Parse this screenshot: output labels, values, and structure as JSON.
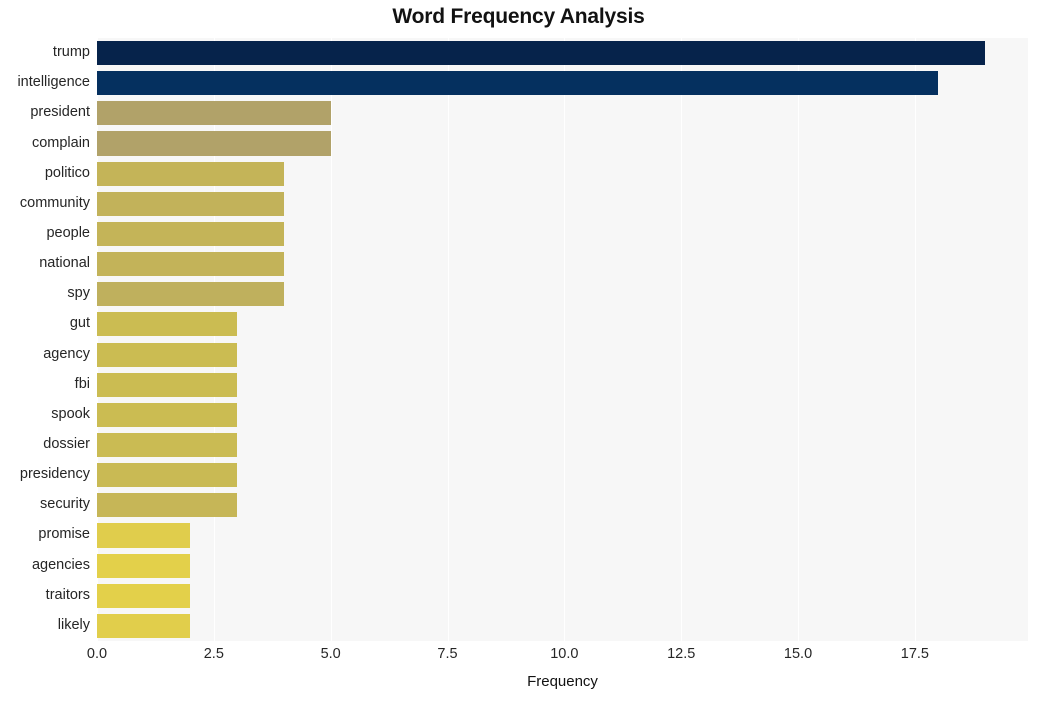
{
  "chart_data": {
    "type": "bar",
    "orientation": "horizontal",
    "title": "Word Frequency Analysis",
    "xlabel": "Frequency",
    "ylabel": "",
    "categories": [
      "trump",
      "intelligence",
      "president",
      "complain",
      "politico",
      "community",
      "people",
      "national",
      "spy",
      "gut",
      "agency",
      "fbi",
      "spook",
      "dossier",
      "presidency",
      "security",
      "promise",
      "agencies",
      "traitors",
      "likely"
    ],
    "values": [
      19,
      18,
      5,
      5,
      4,
      4,
      4,
      4,
      4,
      3,
      3,
      3,
      3,
      3,
      3,
      3,
      2,
      2,
      2,
      2
    ],
    "bar_colors": [
      "#06234b",
      "#05305f",
      "#b1a269",
      "#b1a269",
      "#c4b458",
      "#c2b25a",
      "#c4b458",
      "#c3b359",
      "#bfb05d",
      "#cbbc52",
      "#cbbc52",
      "#cbbc52",
      "#cbbc52",
      "#cabb53",
      "#c9ba54",
      "#c6b657",
      "#e0cd4c",
      "#e3d04a",
      "#e3d04a",
      "#e1ce4b"
    ],
    "xlim": [
      0,
      19.92
    ],
    "xticks": [
      "0.0",
      "2.5",
      "5.0",
      "7.5",
      "10.0",
      "12.5",
      "15.0",
      "17.5"
    ],
    "xtick_values": [
      0,
      2.5,
      5,
      7.5,
      10,
      12.5,
      15,
      17.5
    ],
    "grid": true,
    "grid_color": "#ffffff",
    "plot_background": "#f7f7f7",
    "legend": null
  }
}
